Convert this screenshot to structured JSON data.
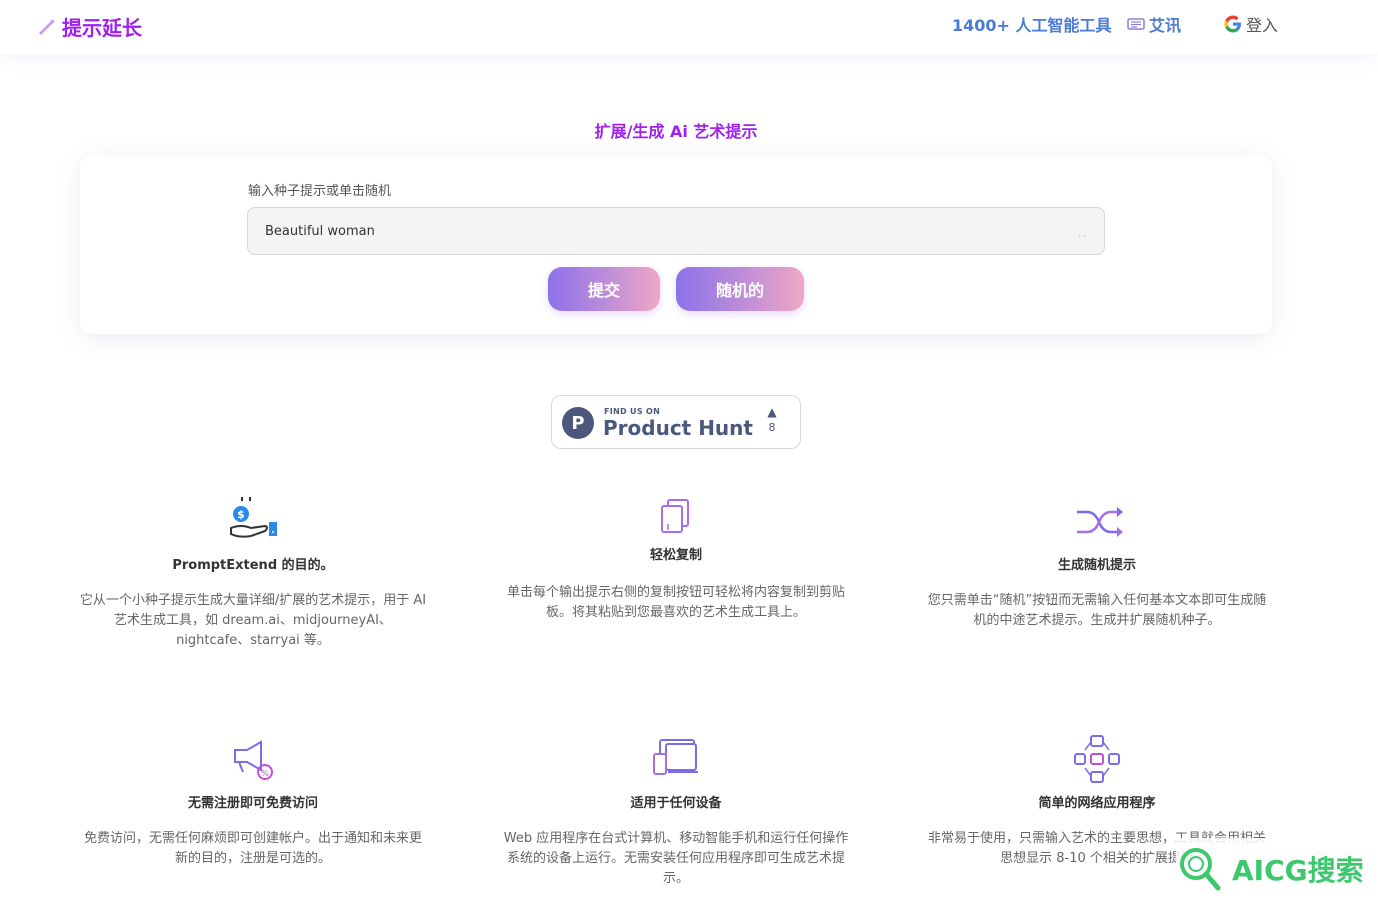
{
  "header": {
    "logo_text": "提示延长",
    "nav_tools": "1400+ 人工智能工具",
    "nav_news": "艾讯",
    "nav_login": "登入"
  },
  "main": {
    "section_title": "扩展/生成 Ai 艺术提示",
    "input_label": "输入种子提示或单击随机",
    "input_value": "Beautiful woman",
    "submit_label": "提交",
    "random_label": "随机的"
  },
  "product_hunt": {
    "small_text": "FIND US ON",
    "big_text": "Product Hunt",
    "logo_letter": "P",
    "vote_count": "8"
  },
  "features": [
    {
      "title": "PromptExtend 的目的。",
      "desc": "它从一个小种子提示生成大量详细/扩展的艺术提示，用于 AI 艺术生成工具，如 dream.ai、midjourneyAI、nightcafe、starryai 等。",
      "icon": "money-hand-icon"
    },
    {
      "title": "轻松复制",
      "desc": "单击每个输出提示右侧的复制按钮可轻松将内容复制到剪贴板。将其粘贴到您最喜欢的艺术生成工具上。",
      "icon": "copy-icon"
    },
    {
      "title": "生成随机提示",
      "desc": "您只需单击“随机”按钮而无需输入任何基本文本即可生成随机的中途艺术提示。生成并扩展随机种子。",
      "icon": "shuffle-icon"
    },
    {
      "title": "无需注册即可免费访问",
      "desc": "免费访问，无需任何麻烦即可创建帐户。出于通知和未来更新的目的，注册是可选的。",
      "icon": "megaphone-icon"
    },
    {
      "title": "适用于任何设备",
      "desc": "Web 应用程序在台式计算机、移动智能手机和运行任何操作系统的设备上运行。无需安装任何应用程序即可生成艺术提示。",
      "icon": "devices-icon"
    },
    {
      "title": "简单的网络应用程序",
      "desc": "非常易于使用，只需输入艺术的主要思想，工具就会用相关思想显示 8-10 个相关的扩展提示",
      "icon": "workflow-icon"
    }
  ],
  "watermark": {
    "text": "AICG搜索"
  },
  "colors": {
    "brand_purple": "#a020f0",
    "nav_blue": "#4b7bd8",
    "button_gradient_start": "#8d72e9",
    "button_gradient_end": "#f0a7c4",
    "ph_color": "#4b587c"
  }
}
